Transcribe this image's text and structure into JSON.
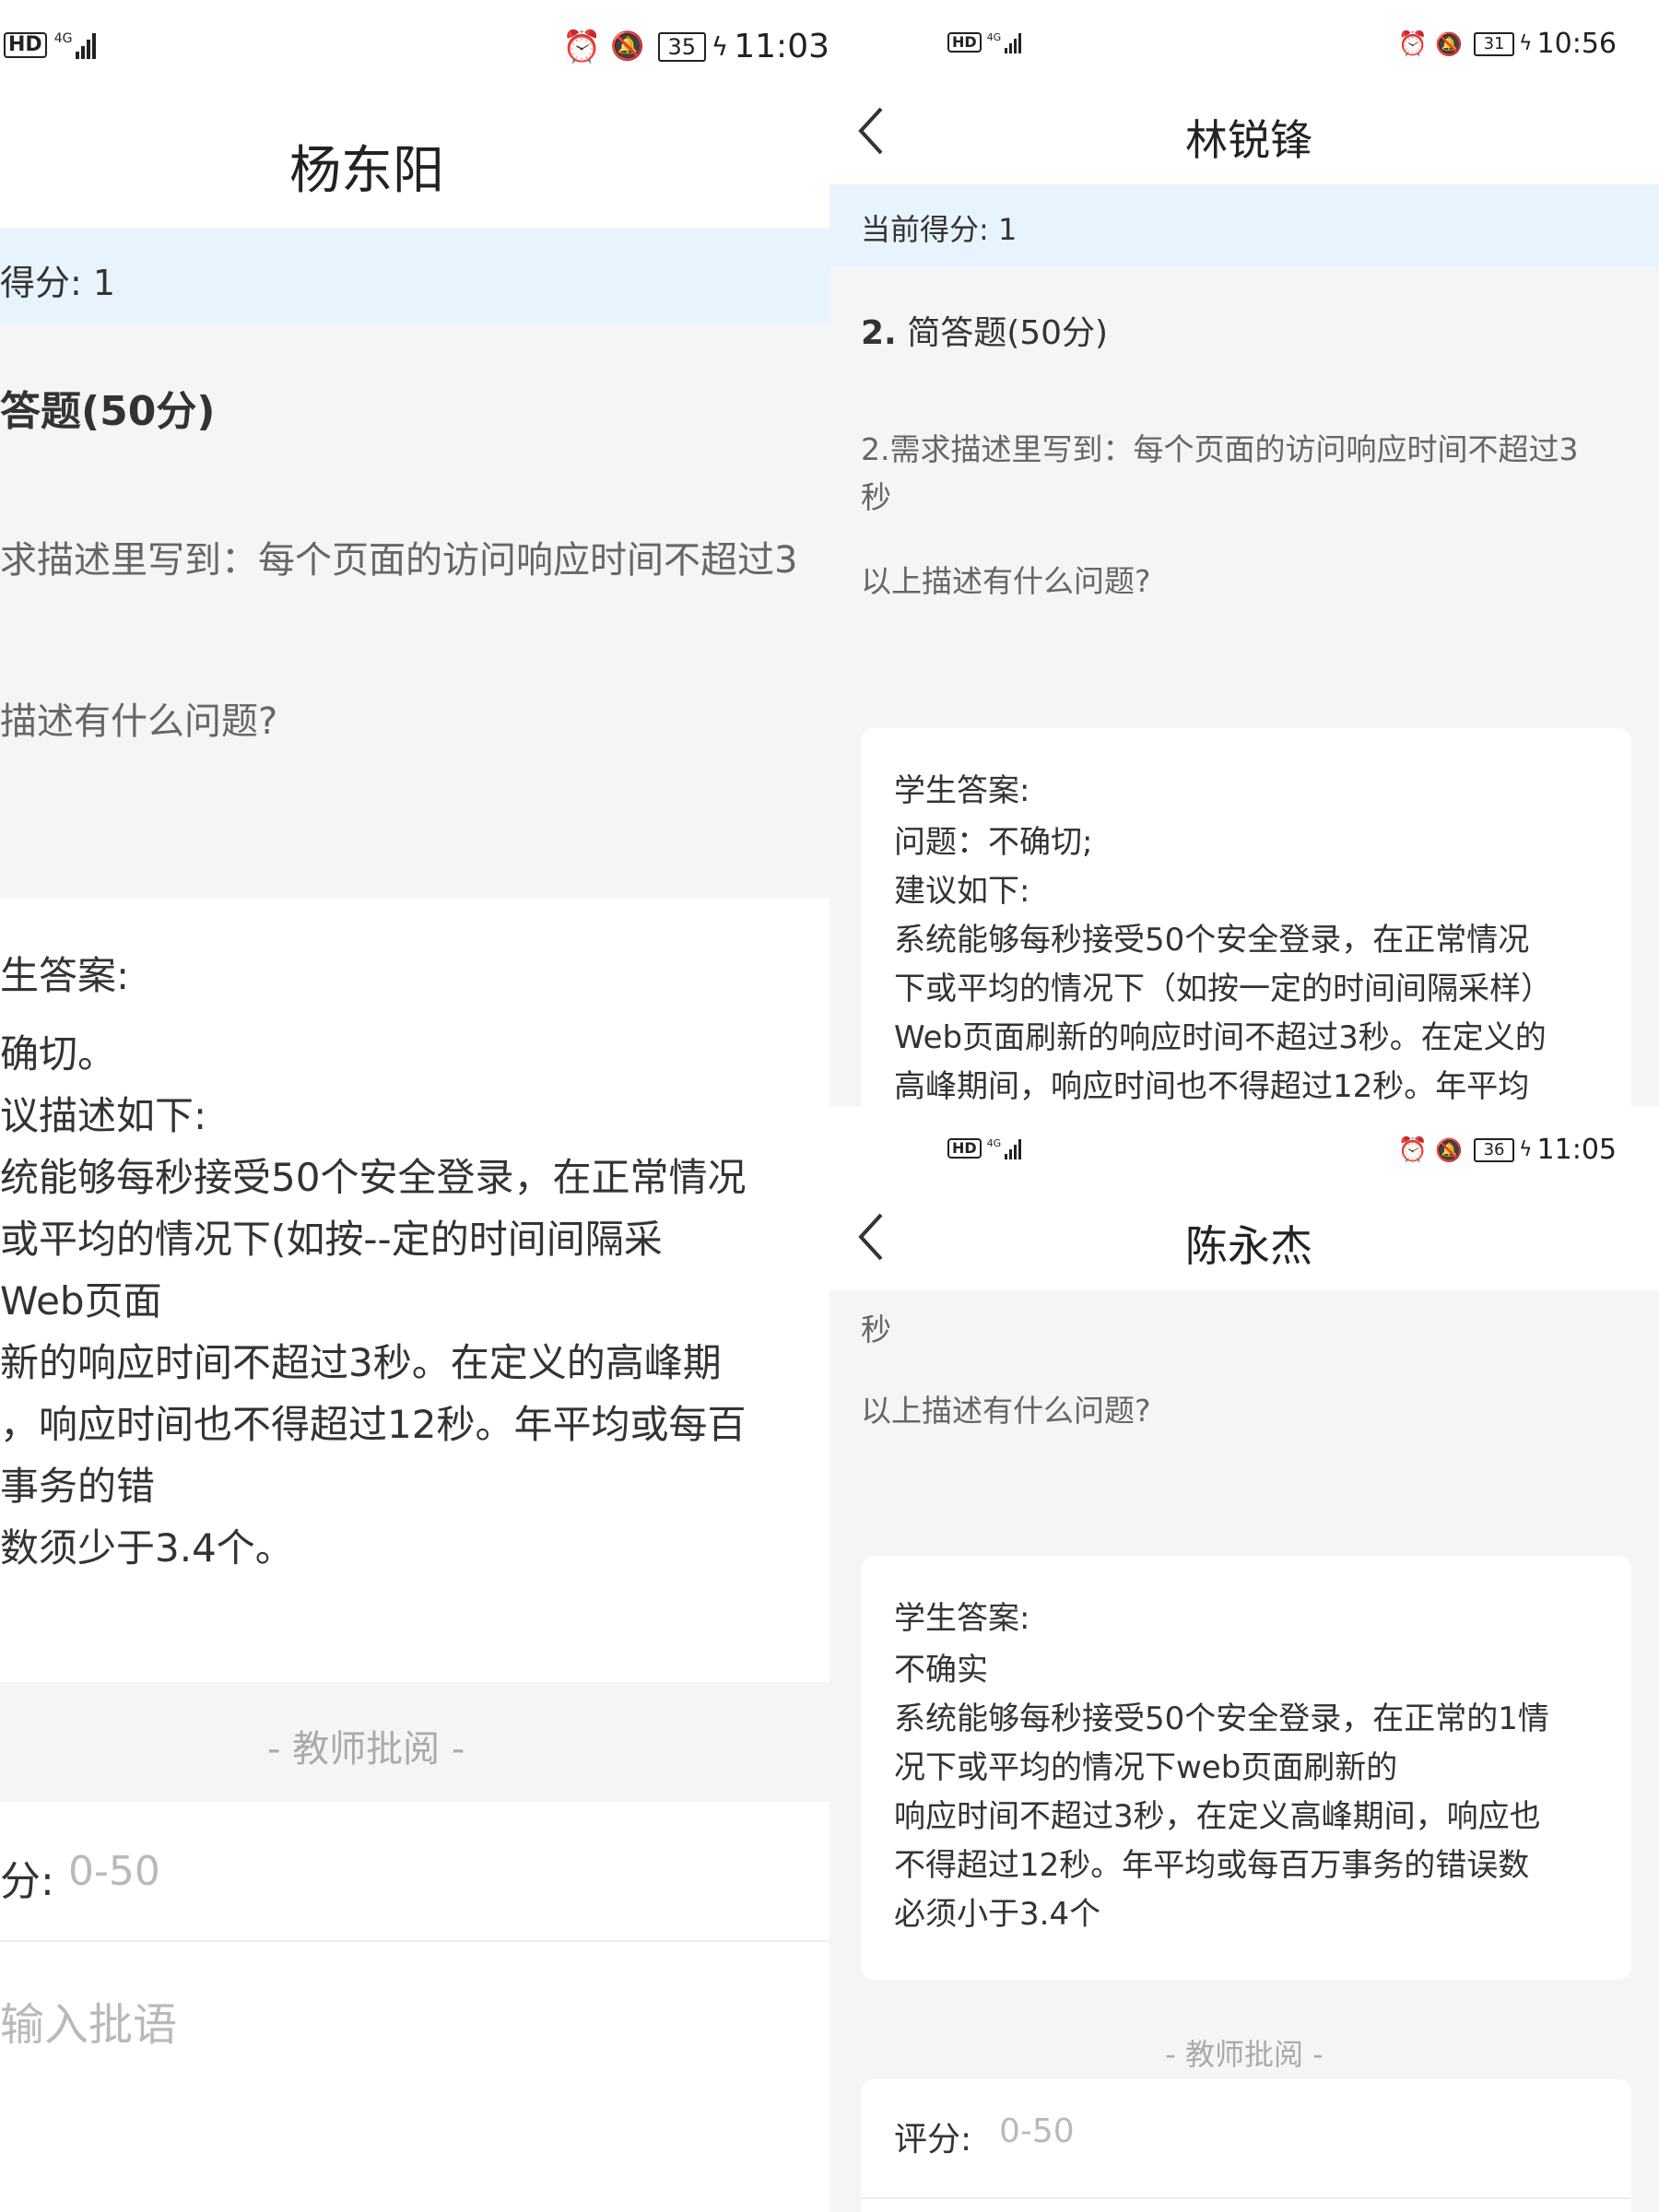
{
  "left": {
    "status": {
      "time": "11:03",
      "battery": "35",
      "hd": "HD",
      "network": "4G"
    },
    "title": "杨东阳",
    "score_label": "得分: 1",
    "question_header": "答题(50分)",
    "question_text": "求描述里写到：每个页面的访问响应时间不超过3",
    "question_sub": "描述有什么问题?",
    "answer_label": "生答案:",
    "answer_lines": [
      "确切。",
      "议描述如下:",
      "统能够每秒接受50个安全登录，在正常情况",
      "或平均的情况下(如按--定的时间间隔采",
      "Web页面",
      "新的响应时间不超过3秒。在定义的高峰期",
      "，响应时间也不得超过12秒。年平均或每百",
      "事务的错",
      "数须少于3.4个。"
    ],
    "review_label": "- 教师批阅 -",
    "score_input_label": "分:",
    "score_placeholder": "0-50",
    "comment_placeholder": "输入批语"
  },
  "topright": {
    "status": {
      "time": "10:56",
      "battery": "31",
      "hd": "HD",
      "network": "4G"
    },
    "title": "林锐锋",
    "score_label": "当前得分: 1",
    "question_num": "2.",
    "question_type": "简答题(50分)",
    "question_text_lines": [
      "2.需求描述里写到：每个页面的访问响应时间不超过3",
      "秒"
    ],
    "question_sub": "以上描述有什么问题?",
    "answer_label": "学生答案:",
    "answer_lines": [
      "问题：不确切;",
      "建议如下:",
      "系统能够每秒接受50个安全登录，在正常情况",
      "下或平均的情况下（如按一定的时间间隔采样）",
      "Web页面刷新的响应时间不超过3秒。在定义的",
      "高峰期间，响应时间也不得超过12秒。年平均"
    ]
  },
  "bottomright": {
    "status": {
      "time": "11:05",
      "battery": "36",
      "hd": "HD",
      "network": "4G"
    },
    "title": "陈永杰",
    "question_tail": "秒",
    "question_sub": "以上描述有什么问题?",
    "answer_label": "学生答案:",
    "answer_lines": [
      "不确实",
      "系统能够每秒接受50个安全登录，在正常的1情",
      "况下或平均的情况下web页面刷新的",
      "响应时间不超过3秒，在定义高峰期间，响应也",
      "不得超过12秒。年平均或每百万事务的错误数",
      "必须小于3.4个"
    ],
    "review_label": "- 教师批阅 -",
    "score_input_label": "评分:",
    "score_placeholder": "0-50"
  }
}
